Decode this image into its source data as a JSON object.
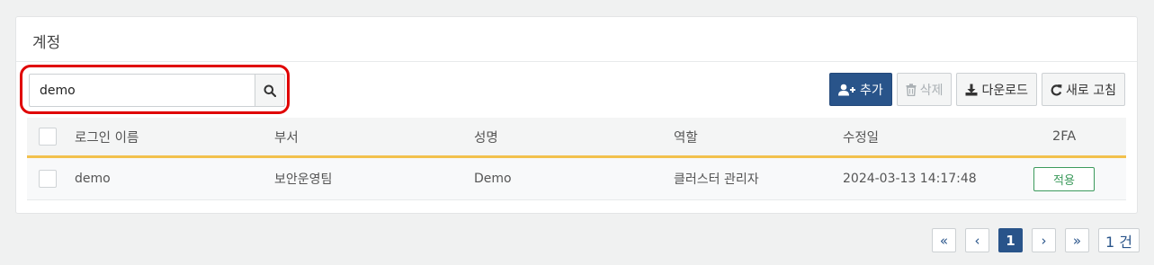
{
  "panel": {
    "title": "계정"
  },
  "search": {
    "value": "demo",
    "placeholder": ""
  },
  "toolbar": {
    "add_label": "추가",
    "delete_label": "삭제",
    "download_label": "다운로드",
    "refresh_label": "새로 고침"
  },
  "table": {
    "headers": {
      "login": "로그인 이름",
      "dept": "부서",
      "name": "성명",
      "role": "역할",
      "modified": "수정일",
      "twofa": "2FA"
    },
    "rows": [
      {
        "login": "demo",
        "dept": "보안운영팀",
        "name": "Demo",
        "role": "클러스터 관리자",
        "modified": "2024-03-13 14:17:48",
        "twofa": "적용"
      }
    ]
  },
  "pagination": {
    "first": "«",
    "prev": "‹",
    "current": "1",
    "next": "›",
    "last": "»",
    "total": "1 건"
  },
  "colors": {
    "primary": "#29548a",
    "highlight": "#e00000",
    "header_underline": "#f2c14d",
    "badge": "#3c9a5c"
  }
}
